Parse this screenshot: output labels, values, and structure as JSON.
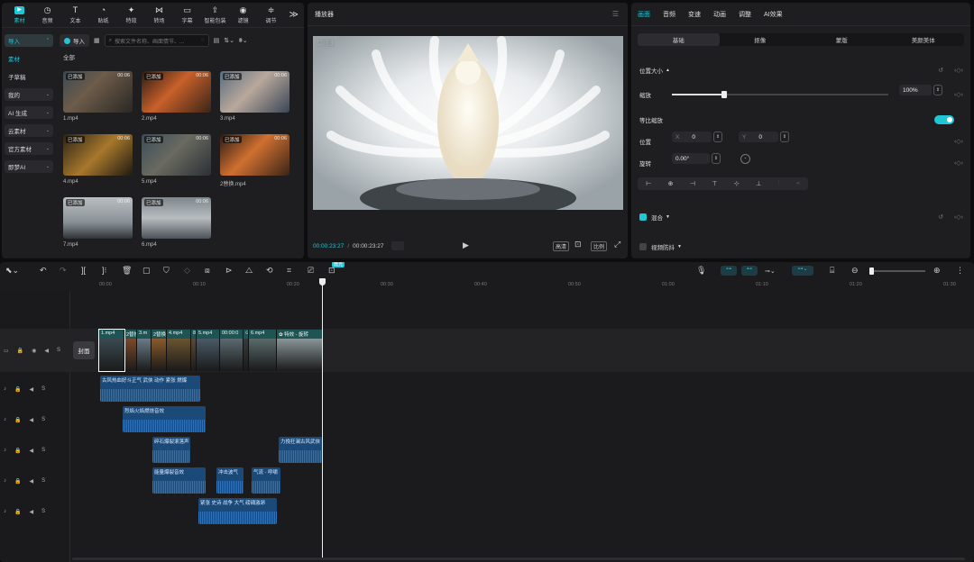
{
  "tabs": [
    {
      "icon": "▶",
      "label": "素材"
    },
    {
      "icon": "◷",
      "label": "音频"
    },
    {
      "icon": "T",
      "label": "文本"
    },
    {
      "icon": "◔",
      "label": "贴纸"
    },
    {
      "icon": "✦",
      "label": "特效"
    },
    {
      "icon": "⋈",
      "label": "转场"
    },
    {
      "icon": "▭",
      "label": "字幕"
    },
    {
      "icon": "⇪",
      "label": "智能包装"
    },
    {
      "icon": "◉",
      "label": "滤镜"
    },
    {
      "icon": "≑",
      "label": "调节"
    }
  ],
  "more": "≫",
  "sidebar": [
    {
      "label": "导入",
      "chev": "⌃"
    },
    {
      "label": "素材",
      "chev": ""
    },
    {
      "label": "子草稿",
      "chev": ""
    },
    {
      "label": "我的",
      "chev": "⌄"
    },
    {
      "label": "AI 生成",
      "chev": "⌄"
    },
    {
      "label": "云素材",
      "chev": "⌄"
    },
    {
      "label": "官方素材",
      "chev": "⌄"
    },
    {
      "label": "即梦AI",
      "chev": "⌄"
    }
  ],
  "media": {
    "import": "导入",
    "search_placeholder": "搜索文件名称、画面情节、...",
    "all": "全部"
  },
  "thumbs": [
    {
      "tag": "已添加",
      "dur": "00:06",
      "name": "1.mp4"
    },
    {
      "tag": "已添加",
      "dur": "00:06",
      "name": "2.mp4"
    },
    {
      "tag": "已添加",
      "dur": "00:06",
      "name": "3.mp4"
    },
    {
      "tag": "已添加",
      "dur": "00:06",
      "name": "4.mp4"
    },
    {
      "tag": "已添加",
      "dur": "00:06",
      "name": "5.mp4"
    },
    {
      "tag": "已添加",
      "dur": "00:06",
      "name": "2替换.mp4"
    },
    {
      "tag": "已添加",
      "dur": "00:06",
      "name": "7.mp4"
    },
    {
      "tag": "已添加",
      "dur": "00:06",
      "name": "6.mp4"
    }
  ],
  "player": {
    "title": "播放器",
    "aitag": "AI生成",
    "current": "00:00:23:27",
    "total": "00:00:23:27",
    "btn_quality": "高清",
    "btn_ratio": "比例"
  },
  "props": {
    "tabs": [
      "画面",
      "音频",
      "变速",
      "动画",
      "调整",
      "AI效果"
    ],
    "subtabs": [
      "基础",
      "抠像",
      "蒙版",
      "美颜美体"
    ],
    "section_pos": "位置大小",
    "scale_label": "缩放",
    "scale_value": "100%",
    "scale_pct": 0.24,
    "uniform_label": "等比缩放",
    "position_label": "位置",
    "x_label": "X",
    "x_value": "0",
    "y_label": "Y",
    "y_value": "0",
    "rotate_label": "旋转",
    "rotate_value": "0.00°",
    "blend_label": "混合",
    "stabilize_label": "视频防抖"
  },
  "timeline": {
    "ruler": [
      "00:00",
      "00:10",
      "00:20",
      "00:30",
      "00:40",
      "00:50",
      "01:00",
      "01:10",
      "01:20",
      "01:30"
    ],
    "cover": "封面",
    "playhead_tag": "微光",
    "tracks": {
      "S": "S"
    },
    "video_clips": [
      "1.mp4",
      "2替换",
      "3.m",
      "2替换",
      "4.mp4",
      "8",
      "5.mp4",
      "00:00:0",
      "⊙",
      "6.mp4",
      "✿ 特效 - 旋转"
    ],
    "audio": [
      {
        "label": "古风热血好斗正气 武侠 动作 紧张 燃爆"
      },
      {
        "label": "烈焰火焰燃烧音效"
      },
      {
        "label": "碎石爆裂滚落声"
      },
      {
        "label": "力挽狂澜古风武侠"
      },
      {
        "label": "能量爆裂音效"
      },
      {
        "label": "冲击波气"
      },
      {
        "label": "气流 - 呼啸"
      },
      {
        "label": "紧张 史诗 战争 大气 磅礴激昂"
      }
    ]
  }
}
